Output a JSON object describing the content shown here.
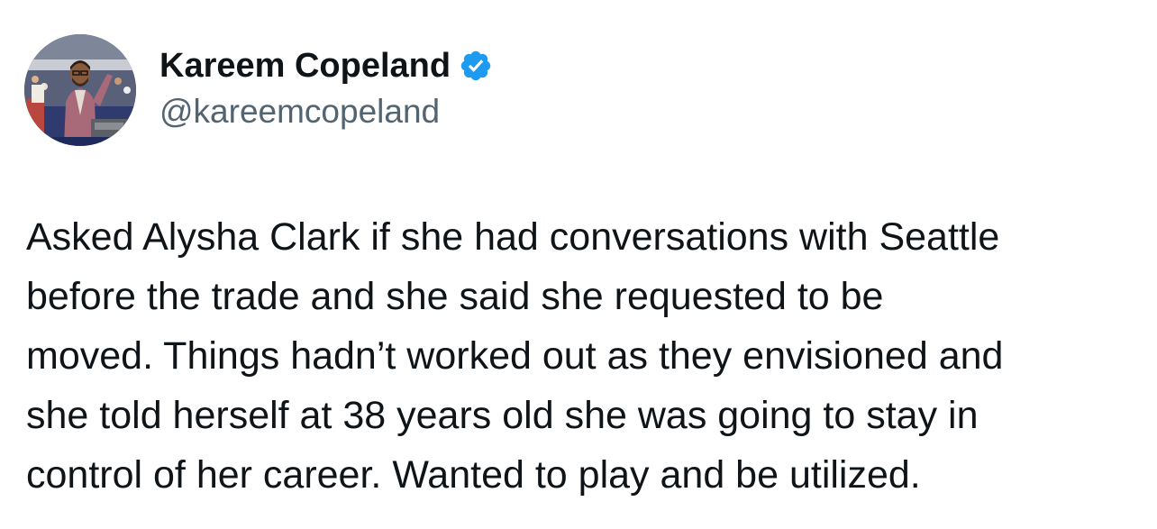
{
  "author": {
    "display_name": "Kareem Copeland",
    "handle": "@kareemcopeland",
    "verified": true,
    "avatar_icon": "profile-photo"
  },
  "tweet": {
    "lines": [
      "Asked Alysha Clark if she had conversations with Seattle",
      "before the trade and she said she requested to be",
      "moved. Things hadn’t worked out as they envisioned and",
      "she told herself at 38 years old she was going to stay in",
      "control of her career. Wanted to play and be utilized."
    ]
  },
  "colors": {
    "text_primary": "#0f1419",
    "text_secondary": "#536471",
    "verified_badge": "#1d9bf0",
    "background": "#ffffff"
  }
}
